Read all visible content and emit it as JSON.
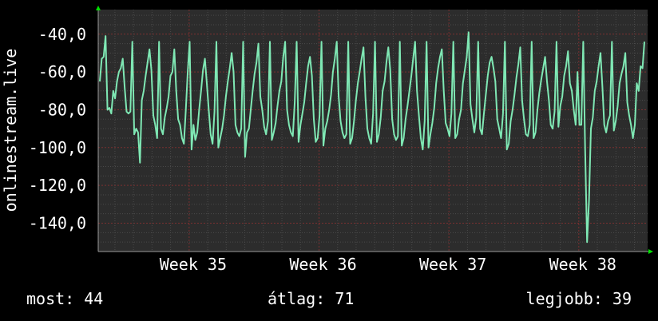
{
  "chart_data": {
    "type": "line",
    "ylabel": "onlinestream.live",
    "xlabel": "",
    "title": "",
    "ylim": [
      -155,
      -27
    ],
    "y_ticks": [
      "-40,0",
      "-60,0",
      "-80,0",
      "-100,0",
      "-120,0",
      "-140,0"
    ],
    "y_tick_values": [
      -40,
      -60,
      -80,
      -100,
      -120,
      -140
    ],
    "x_ticks": [
      "Week 35",
      "Week 36",
      "Week 37",
      "Week 38"
    ],
    "x_tick_values": [
      35,
      36,
      37,
      38
    ],
    "xlim": [
      34.3,
      38.53
    ],
    "grid": true,
    "line_color": "#7fe8b4",
    "plot_background": "#2c2c2c",
    "series": [
      {
        "values": [
          -65,
          -53,
          -52,
          -41,
          -80,
          -79,
          -82,
          -70,
          -74,
          -65,
          -60,
          -58,
          -53,
          -68,
          -81,
          -82,
          -81,
          -44,
          -93,
          -90,
          -92,
          -108,
          -75,
          -70,
          -62,
          -55,
          -48,
          -59,
          -83,
          -88,
          -95,
          -44,
          -90,
          -93,
          -84,
          -79,
          -73,
          -62,
          -60,
          -48,
          -70,
          -85,
          -88,
          -95,
          -98,
          -80,
          -60,
          -44,
          -101,
          -88,
          -96,
          -92,
          -80,
          -70,
          -59,
          -53,
          -66,
          -80,
          -93,
          -98,
          -81,
          -44,
          -100,
          -95,
          -90,
          -83,
          -73,
          -65,
          -58,
          -50,
          -60,
          -88,
          -92,
          -94,
          -90,
          -44,
          -105,
          -92,
          -90,
          -80,
          -70,
          -61,
          -55,
          -45,
          -73,
          -80,
          -89,
          -93,
          -86,
          -44,
          -96,
          -92,
          -87,
          -78,
          -70,
          -65,
          -52,
          -44,
          -80,
          -88,
          -92,
          -94,
          -76,
          -44,
          -97,
          -88,
          -82,
          -76,
          -66,
          -57,
          -52,
          -62,
          -85,
          -97,
          -95,
          -83,
          -44,
          -99,
          -90,
          -86,
          -80,
          -72,
          -60,
          -53,
          -44,
          -73,
          -86,
          -92,
          -95,
          -93,
          -44,
          -98,
          -95,
          -86,
          -75,
          -66,
          -60,
          -53,
          -47,
          -73,
          -90,
          -95,
          -98,
          -82,
          -44,
          -97,
          -93,
          -84,
          -70,
          -65,
          -55,
          -47,
          -59,
          -85,
          -93,
          -96,
          -94,
          -44,
          -99,
          -95,
          -85,
          -78,
          -70,
          -62,
          -53,
          -44,
          -70,
          -83,
          -95,
          -101,
          -86,
          -44,
          -100,
          -93,
          -87,
          -79,
          -66,
          -58,
          -52,
          -48,
          -70,
          -87,
          -90,
          -94,
          -82,
          -44,
          -95,
          -93,
          -85,
          -80,
          -66,
          -59,
          -52,
          -39,
          -77,
          -85,
          -92,
          -84,
          -44,
          -90,
          -93,
          -82,
          -72,
          -62,
          -55,
          -52,
          -58,
          -65,
          -85,
          -90,
          -95,
          -82,
          -44,
          -101,
          -98,
          -86,
          -80,
          -72,
          -63,
          -56,
          -47,
          -75,
          -85,
          -93,
          -94,
          -88,
          -44,
          -95,
          -92,
          -80,
          -71,
          -64,
          -58,
          -52,
          -65,
          -75,
          -88,
          -90,
          -81,
          -44,
          -89,
          -78,
          -73,
          -62,
          -57,
          -49,
          -66,
          -70,
          -80,
          -88,
          -60,
          -88,
          -88,
          -44,
          -102,
          -150,
          -128,
          -90,
          -84,
          -70,
          -65,
          -57,
          -50,
          -68,
          -88,
          -92,
          -86,
          -83,
          -44,
          -91,
          -86,
          -78,
          -66,
          -61,
          -57,
          -50,
          -76,
          -83,
          -88,
          -95,
          -88,
          -66,
          -70,
          -57,
          -58,
          -44
        ]
      }
    ]
  },
  "footer": {
    "current": "most: 44",
    "average": "átlag: 71",
    "best": "legjobb: 39"
  }
}
